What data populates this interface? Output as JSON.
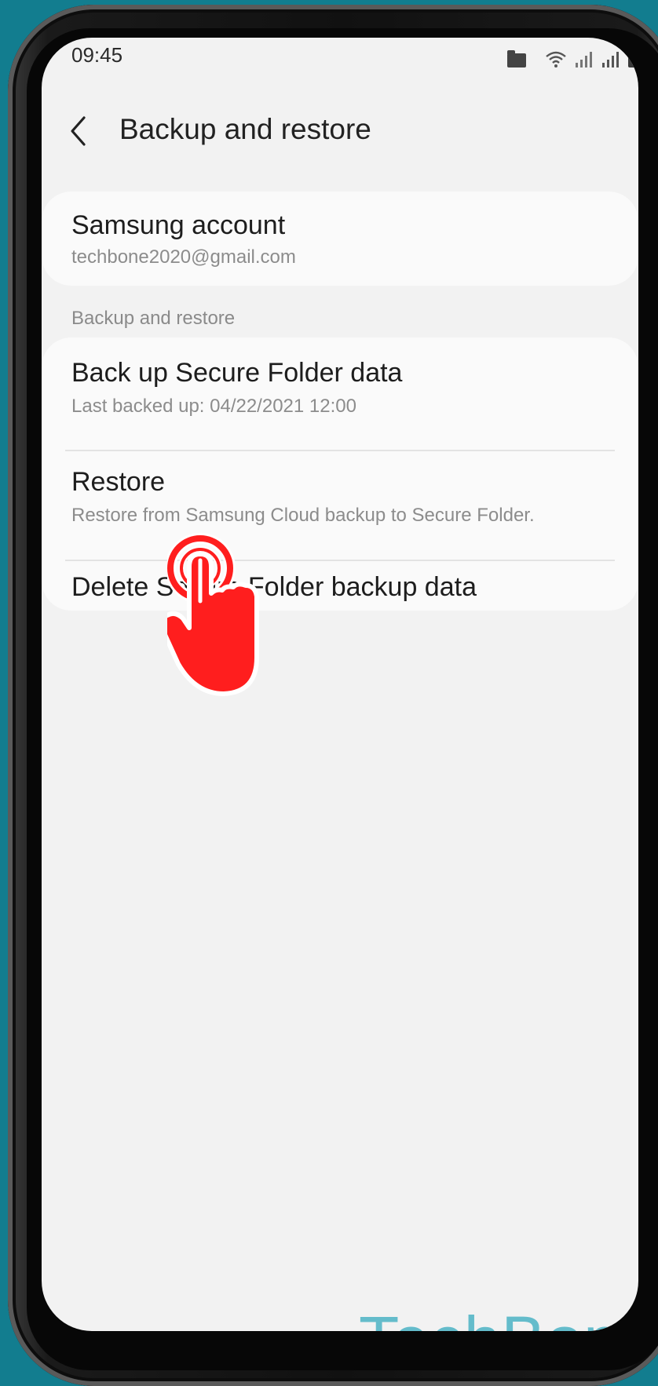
{
  "status_bar": {
    "time": "09:45",
    "icons": [
      "folder-icon",
      "wifi-icon",
      "signal-icon",
      "signal-icon",
      "battery-icon"
    ]
  },
  "app_bar": {
    "title": "Backup and restore",
    "back_icon": "chevron-left-icon"
  },
  "account": {
    "title": "Samsung account",
    "email": "techbone2020@gmail.com"
  },
  "section": {
    "header": "Backup and restore",
    "items": [
      {
        "title": "Back up Secure Folder data",
        "subtitle": "Last backed up: 04/22/2021 12:00"
      },
      {
        "title": "Restore",
        "subtitle": "Restore from Samsung Cloud backup to Secure Folder."
      },
      {
        "title": "Delete Secure Folder backup data",
        "subtitle": ""
      }
    ]
  },
  "overlay": {
    "tap_indicator": "hand-tap-icon",
    "color": "#ff1e1e"
  },
  "watermark": "TechBone",
  "colors": {
    "background": "#127d8f",
    "screen": "#f2f2f2",
    "card": "#fafafa",
    "watermark": "#64bccb"
  }
}
